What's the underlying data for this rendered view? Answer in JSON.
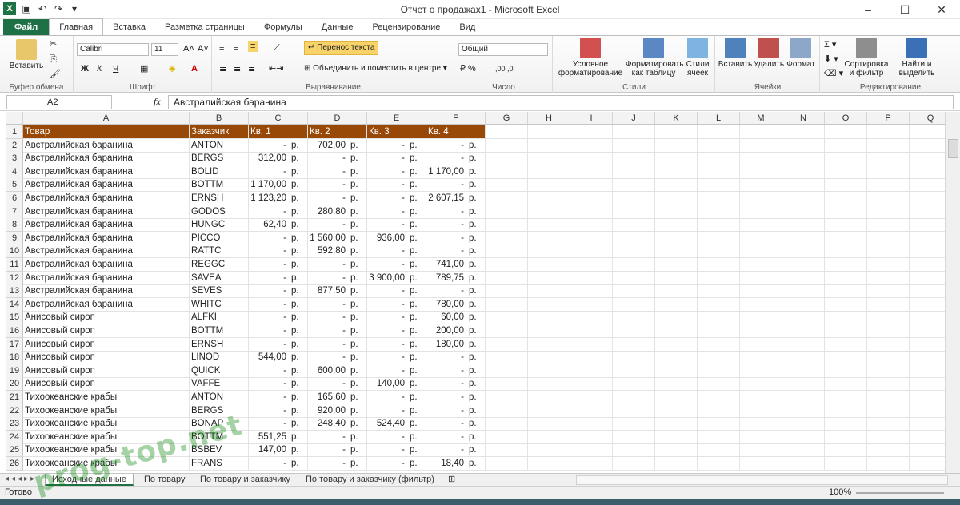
{
  "window": {
    "title": "Отчет о продажах1  -  Microsoft Excel"
  },
  "tabs": [
    "Файл",
    "Главная",
    "Вставка",
    "Разметка страницы",
    "Формулы",
    "Данные",
    "Рецензирование",
    "Вид"
  ],
  "ribbon": {
    "clipboard": {
      "paste": "Вставить",
      "label": "Буфер обмена"
    },
    "font": {
      "name": "Calibri",
      "size": "11",
      "bold": "Ж",
      "italic": "К",
      "underline": "Ч",
      "label": "Шрифт"
    },
    "align": {
      "wrap": "Перенос текста",
      "merge": "Объединить и поместить в центре",
      "label": "Выравнивание"
    },
    "number": {
      "format": "Общий",
      "label": "Число"
    },
    "styles": {
      "cond": "Условное форматирование",
      "astable": "Форматировать как таблицу",
      "cellstyles": "Стили ячеек",
      "label": "Стили"
    },
    "cells": {
      "insert": "Вставить",
      "delete": "Удалить",
      "format": "Формат",
      "label": "Ячейки"
    },
    "editing": {
      "sort": "Сортировка и фильтр",
      "find": "Найти и выделить",
      "label": "Редактирование"
    }
  },
  "formula": {
    "namebox": "A2",
    "fx": "fx",
    "content": "Австралийская баранина"
  },
  "columns": [
    "A",
    "B",
    "C",
    "D",
    "E",
    "F",
    "G",
    "H",
    "I",
    "J",
    "K",
    "L",
    "M",
    "N",
    "O",
    "P",
    "Q"
  ],
  "header": [
    "Товар",
    "Заказчик",
    "Кв. 1",
    "Кв. 2",
    "Кв. 3",
    "Кв. 4"
  ],
  "rows": [
    [
      "Австралийская баранина",
      "ANTON",
      "-",
      "702,00",
      "-",
      "-"
    ],
    [
      "Австралийская баранина",
      "BERGS",
      "312,00",
      "-",
      "-",
      "-"
    ],
    [
      "Австралийская баранина",
      "BOLID",
      "-",
      "-",
      "-",
      "1 170,00"
    ],
    [
      "Австралийская баранина",
      "BOTTM",
      "1 170,00",
      "-",
      "-",
      "-"
    ],
    [
      "Австралийская баранина",
      "ERNSH",
      "1 123,20",
      "-",
      "-",
      "2 607,15"
    ],
    [
      "Австралийская баранина",
      "GODOS",
      "-",
      "280,80",
      "-",
      "-"
    ],
    [
      "Австралийская баранина",
      "HUNGC",
      "62,40",
      "-",
      "-",
      "-"
    ],
    [
      "Австралийская баранина",
      "PICCO",
      "-",
      "1 560,00",
      "936,00",
      "-"
    ],
    [
      "Австралийская баранина",
      "RATTC",
      "-",
      "592,80",
      "-",
      "-"
    ],
    [
      "Австралийская баранина",
      "REGGC",
      "-",
      "-",
      "-",
      "741,00"
    ],
    [
      "Австралийская баранина",
      "SAVEA",
      "-",
      "-",
      "3 900,00",
      "789,75"
    ],
    [
      "Австралийская баранина",
      "SEVES",
      "-",
      "877,50",
      "-",
      "-"
    ],
    [
      "Австралийская баранина",
      "WHITC",
      "-",
      "-",
      "-",
      "780,00"
    ],
    [
      "Анисовый сироп",
      "ALFKI",
      "-",
      "-",
      "-",
      "60,00"
    ],
    [
      "Анисовый сироп",
      "BOTTM",
      "-",
      "-",
      "-",
      "200,00"
    ],
    [
      "Анисовый сироп",
      "ERNSH",
      "-",
      "-",
      "-",
      "180,00"
    ],
    [
      "Анисовый сироп",
      "LINOD",
      "544,00",
      "-",
      "-",
      "-"
    ],
    [
      "Анисовый сироп",
      "QUICK",
      "-",
      "600,00",
      "-",
      "-"
    ],
    [
      "Анисовый сироп",
      "VAFFE",
      "-",
      "-",
      "140,00",
      "-"
    ],
    [
      "Тихоокеанские крабы",
      "ANTON",
      "-",
      "165,60",
      "-",
      "-"
    ],
    [
      "Тихоокеанские крабы",
      "BERGS",
      "-",
      "920,00",
      "-",
      "-"
    ],
    [
      "Тихоокеанские крабы",
      "BONAP",
      "-",
      "248,40",
      "524,40",
      "-"
    ],
    [
      "Тихоокеанские крабы",
      "BOTTM",
      "551,25",
      "-",
      "-",
      "-"
    ],
    [
      "Тихоокеанские крабы",
      "BSBEV",
      "147,00",
      "-",
      "-",
      "-"
    ],
    [
      "Тихоокеанские крабы",
      "FRANS",
      "-",
      "-",
      "-",
      "18,40"
    ]
  ],
  "currency": "р.",
  "sheets": [
    "Исходные данные",
    "По товару",
    "По товару и заказчику",
    "По товару и заказчику (фильтр)"
  ],
  "status": {
    "ready": "Готово",
    "zoom": "100%"
  },
  "watermark": "prog-top.net"
}
